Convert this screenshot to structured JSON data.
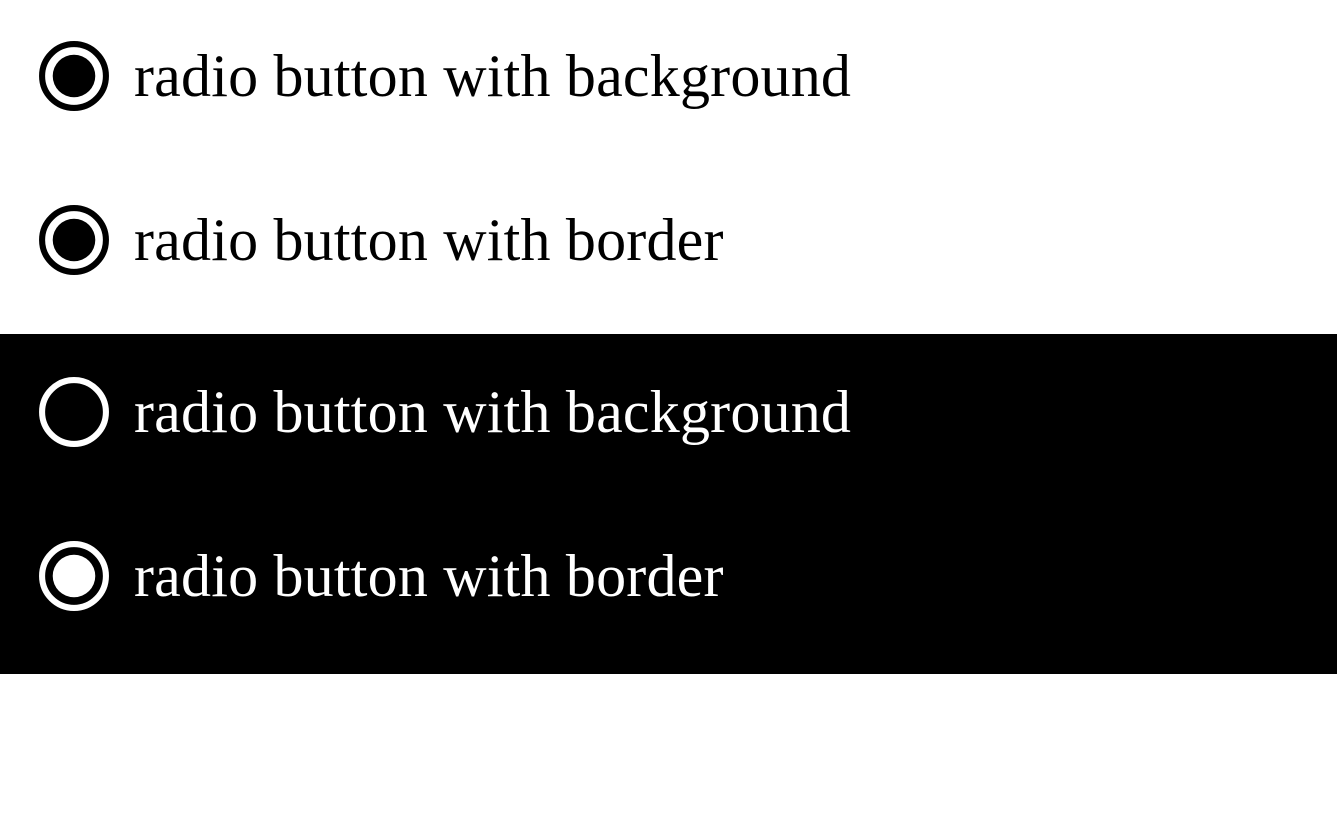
{
  "light": {
    "items": [
      {
        "label": "radio button with background",
        "inner_fill": "#000000",
        "ring_stroke": "#000000"
      },
      {
        "label": "radio button with border",
        "inner_fill": "#000000",
        "ring_stroke": "#000000"
      }
    ]
  },
  "dark": {
    "items": [
      {
        "label": "radio button with background",
        "inner_fill": "none",
        "ring_stroke": "#ffffff"
      },
      {
        "label": "radio button with border",
        "inner_fill": "#ffffff",
        "ring_stroke": "#ffffff"
      }
    ]
  }
}
